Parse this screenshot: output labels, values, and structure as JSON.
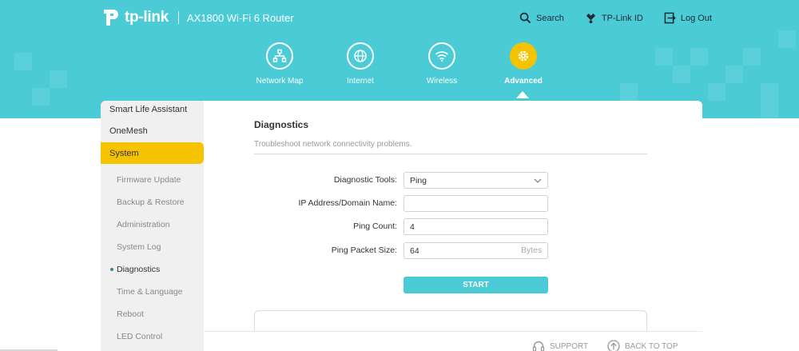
{
  "header": {
    "brand": "tp-link",
    "model": "AX1800 Wi-Fi 6 Router",
    "links": [
      {
        "label": "Search",
        "icon": "search-icon"
      },
      {
        "label": "TP-Link ID",
        "icon": "user-icon"
      },
      {
        "label": "Log Out",
        "icon": "logout-icon"
      }
    ]
  },
  "nav": {
    "items": [
      {
        "label": "Network Map",
        "icon": "network-map-icon"
      },
      {
        "label": "Internet",
        "icon": "globe-icon"
      },
      {
        "label": "Wireless",
        "icon": "wifi-icon"
      },
      {
        "label": "Advanced",
        "icon": "gear-icon",
        "active": true
      }
    ]
  },
  "sidebar": {
    "top_items": [
      "Smart Life Assistant",
      "OneMesh",
      "System"
    ],
    "active": "System",
    "sub_items": [
      "Firmware Update",
      "Backup & Restore",
      "Administration",
      "System Log",
      "Diagnostics",
      "Time & Language",
      "Reboot",
      "LED Control"
    ],
    "current": "Diagnostics"
  },
  "panel": {
    "title": "Diagnostics",
    "description": "Troubleshoot network connectivity problems.",
    "fields": {
      "tool_label": "Diagnostic Tools:",
      "tool_value": "Ping",
      "ip_label": "IP Address/Domain Name:",
      "ip_value": "",
      "count_label": "Ping Count:",
      "count_value": "4",
      "size_label": "Ping Packet Size:",
      "size_value": "64",
      "size_unit": "Bytes"
    },
    "start_label": "START"
  },
  "footer": {
    "support_label": "SUPPORT",
    "back_to_top_label": "BACK TO TOP"
  },
  "colors": {
    "header_bg": "#4acbd6",
    "accent_yellow": "#f5c300",
    "button": "#4acbd6"
  }
}
